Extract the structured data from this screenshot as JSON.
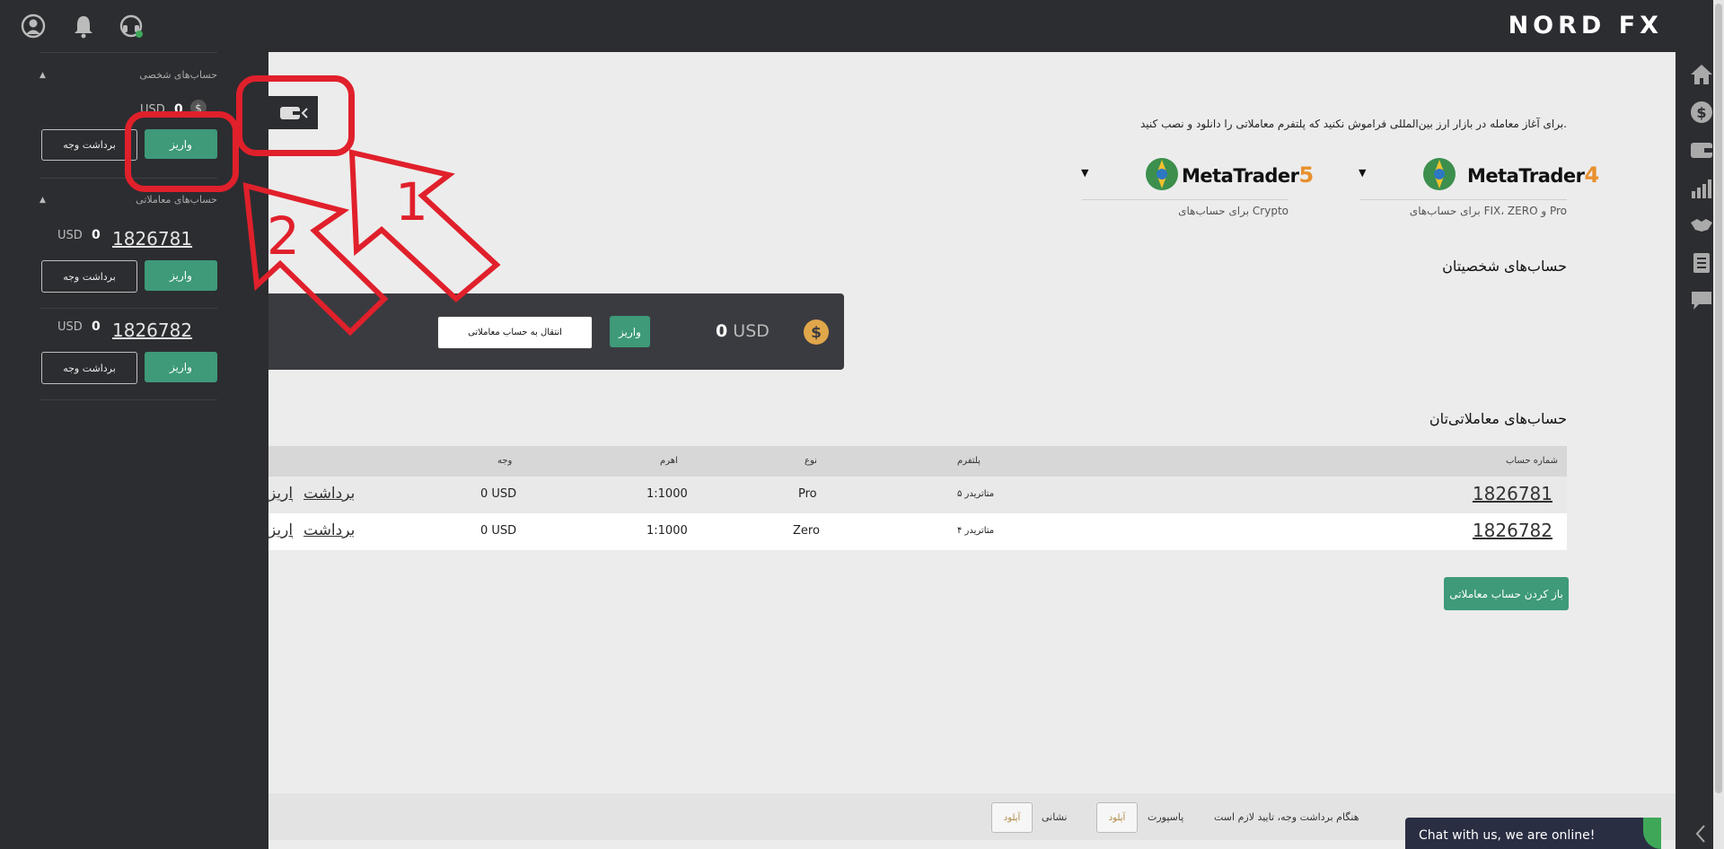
{
  "brand": {
    "logo_text": "NORD FX"
  },
  "topbar": {
    "icons": [
      "user-icon",
      "bell-icon",
      "support-headset-icon"
    ]
  },
  "rightrail": {
    "icons": [
      "home-icon",
      "dollar-icon",
      "wallet-icon",
      "chart-icon",
      "handshake-icon",
      "document-icon",
      "chat-icon"
    ]
  },
  "sidebar": {
    "personal_title": "حساب‌های شخصی",
    "personal": {
      "currency": "USD",
      "balance": "0",
      "deposit_label": "واریز",
      "withdraw_label": "برداشت وجه"
    },
    "trading_title": "حساب‌های معاملاتی",
    "accounts": [
      {
        "number": "1826781",
        "currency": "USD",
        "balance": "0",
        "deposit_label": "واریز",
        "withdraw_label": "برداشت وجه"
      },
      {
        "number": "1826782",
        "currency": "USD",
        "balance": "0",
        "deposit_label": "واریز",
        "withdraw_label": "برداشت وجه"
      }
    ]
  },
  "main": {
    "note": "برای آغاز معامله در بازار ارز بین‌المللی فراموش نکنید که پلتفرم معاملاتی را دانلود و نصب کنید.",
    "platforms": [
      {
        "name": "MetaTrader",
        "version": "4",
        "version_color": "#e8902e",
        "sub": "برای حساب‌های FIX، ZERO و Pro"
      },
      {
        "name": "MetaTrader",
        "version": "5",
        "version_color": "#e8902e",
        "sub": "برای حساب‌های Crypto"
      }
    ],
    "personal_heading": "حساب‌های شخصیتان",
    "personal_card": {
      "balance": "0",
      "currency": "USD",
      "deposit_label": "واریز",
      "transfer_label": "انتقال به حساب معاملاتی"
    },
    "trading_heading": "حساب‌های معاملاتی‌تان",
    "table": {
      "headers": {
        "account": "شماره حساب",
        "platform": "پلتفرم",
        "type": "نوع",
        "leverage": "اهرم",
        "funds": "وجه"
      },
      "rows": [
        {
          "account": "1826781",
          "platform": "متاتریدر ۵",
          "type": "Pro",
          "leverage": "1:1000",
          "funds": "0 USD",
          "withdraw": "برداشت",
          "deposit": "واریز"
        },
        {
          "account": "1826782",
          "platform": "متاتریدر ۴",
          "type": "Zero",
          "leverage": "1:1000",
          "funds": "0 USD",
          "withdraw": "برداشت",
          "deposit": "واریز"
        }
      ]
    },
    "open_account_label": "باز کردن حساب معاملاتی"
  },
  "footer": {
    "note": "هنگام برداشت وجه، تایید لازم است",
    "passport_label": "پاسپورت",
    "address_label": "نشانی",
    "upload_label": "آپلود"
  },
  "chat": {
    "label": "Chat with us, we are online!"
  },
  "annotations": {
    "arrow1_label": "1",
    "arrow2_label": "2",
    "color": "#e0202b"
  }
}
